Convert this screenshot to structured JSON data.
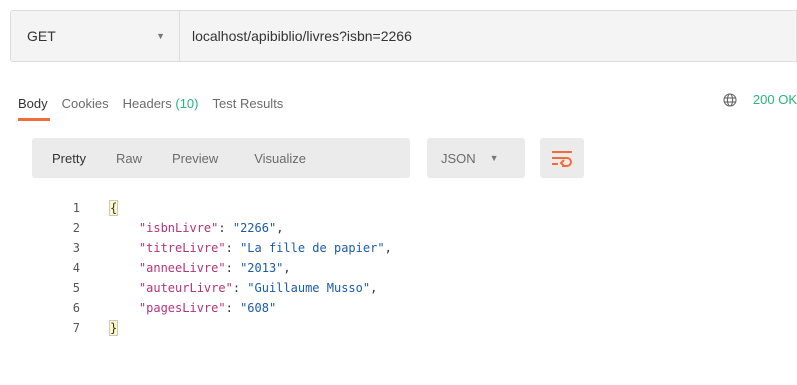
{
  "request": {
    "method": "GET",
    "url": "localhost/apibiblio/livres?isbn=2266"
  },
  "response_tabs": [
    {
      "label": "Body"
    },
    {
      "label": "Cookies"
    },
    {
      "label": "Headers",
      "count": "(10)"
    },
    {
      "label": "Test Results"
    }
  ],
  "status": {
    "text": "200 OK",
    "color": "#26b47f"
  },
  "viewer": {
    "modes": [
      "Pretty",
      "Raw",
      "Preview",
      "Visualize"
    ],
    "format": "JSON"
  },
  "accent_color": "#f26b3a",
  "code_lines": [
    {
      "num": "1",
      "text": "{"
    },
    {
      "num": "2",
      "key": "\"isbnLivre\"",
      "value": "\"2266\"",
      "trail": ","
    },
    {
      "num": "3",
      "key": "\"titreLivre\"",
      "value": "\"La fille de papier\"",
      "trail": ","
    },
    {
      "num": "4",
      "key": "\"anneeLivre\"",
      "value": "\"2013\"",
      "trail": ","
    },
    {
      "num": "5",
      "key": "\"auteurLivre\"",
      "value": "\"Guillaume Musso\"",
      "trail": ","
    },
    {
      "num": "6",
      "key": "\"pagesLivre\"",
      "value": "\"608\"",
      "trail": ""
    },
    {
      "num": "7",
      "text": "}"
    }
  ]
}
